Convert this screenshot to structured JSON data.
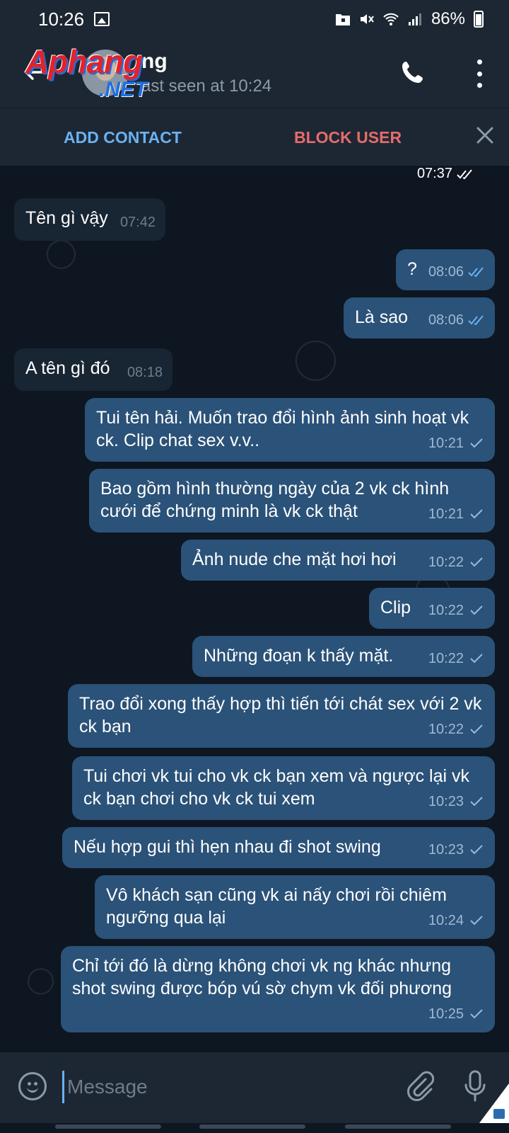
{
  "status_bar": {
    "time": "10:26",
    "battery": "86%"
  },
  "header": {
    "back_icon": "arrow-back-icon",
    "contact_name": "ng",
    "last_seen": "ast seen at 10:24",
    "watermark": "Aphang",
    "watermark_suffix": ".NET",
    "call_icon": "phone-icon",
    "more_icon": "more-vertical-icon"
  },
  "action_bar": {
    "add_contact": "ADD CONTACT",
    "block_user": "BLOCK USER",
    "close_icon": "close-icon"
  },
  "chat": {
    "top_stamp": "07:37",
    "messages": [
      {
        "dir": "in",
        "text": "Tên gì vậy",
        "time": "07:42"
      },
      {
        "dir": "out",
        "text": "?",
        "time": "08:06",
        "read": true
      },
      {
        "dir": "out",
        "text": "Là sao",
        "time": "08:06",
        "read": true
      },
      {
        "dir": "in",
        "text": "A tên gì đó",
        "time": "08:18"
      },
      {
        "dir": "out",
        "text": "Tui tên hải. Muốn trao đổi hình ảnh sinh hoạt vk ck. Clip chat sex v.v..",
        "time": "10:21",
        "read": false
      },
      {
        "dir": "out",
        "text": "Bao gồm hình thường ngày của 2 vk ck hình cưới để chứng minh là vk ck thật",
        "time": "10:21",
        "read": false
      },
      {
        "dir": "out",
        "text": "Ảnh nude che mặt hơi hơi",
        "time": "10:22",
        "read": false
      },
      {
        "dir": "out",
        "text": "Clip",
        "time": "10:22",
        "read": false
      },
      {
        "dir": "out",
        "text": "Những đoạn k thấy mặt.",
        "time": "10:22",
        "read": false
      },
      {
        "dir": "out",
        "text": "Trao đổi xong thấy hợp thì tiến tới chát sex với 2 vk ck bạn",
        "time": "10:22",
        "read": false
      },
      {
        "dir": "out",
        "text": "Tui chơi vk tui cho vk ck bạn xem và ngược lại vk ck bạn chơi cho vk ck tui xem",
        "time": "10:23",
        "read": false
      },
      {
        "dir": "out",
        "text": "Nếu hợp gui thì hẹn nhau đi shot swing",
        "time": "10:23",
        "read": false
      },
      {
        "dir": "out",
        "text": "Vô khách sạn cũng vk ai nấy chơi rồi chiêm ngưỡng qua lại",
        "time": "10:24",
        "read": false
      },
      {
        "dir": "out",
        "text": "Chỉ tới đó là dừng không chơi vk ng khác nhưng shot swing được bóp vú sờ chym vk đối phương",
        "time": "10:25",
        "read": false
      }
    ]
  },
  "composer": {
    "placeholder": "Message",
    "emoji_icon": "emoji-icon",
    "attach_icon": "paperclip-icon",
    "mic_icon": "microphone-icon"
  },
  "colors": {
    "background": "#0e1621",
    "header": "#1d2733",
    "incoming_bubble": "#182533",
    "outgoing_bubble": "#2b5278",
    "accent": "#6ab2f2",
    "danger": "#e46c6c"
  }
}
